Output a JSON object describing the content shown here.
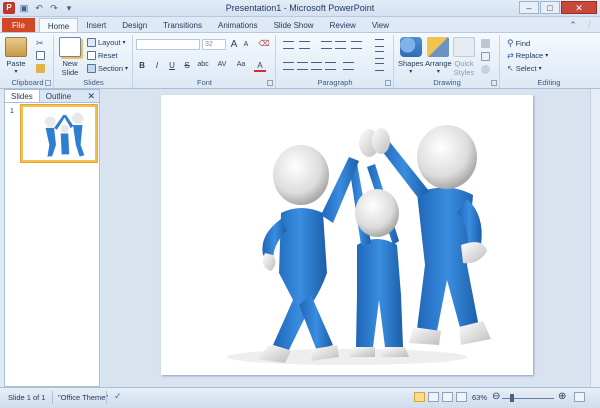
{
  "window": {
    "title": "Presentation1 - Microsoft PowerPoint",
    "quick_access": [
      "save-icon",
      "undo-icon",
      "redo-icon",
      "customize-icon"
    ],
    "controls": [
      "minimize-icon",
      "maximize-icon",
      "close-icon"
    ]
  },
  "tabs": [
    "File",
    "Home",
    "Insert",
    "Design",
    "Transitions",
    "Animations",
    "Slide Show",
    "Review",
    "View"
  ],
  "active_tab": "Home",
  "ribbon": {
    "clipboard": {
      "paste": "Paste",
      "label": "Clipboard"
    },
    "slides": {
      "new_slide_line1": "New",
      "new_slide_line2": "Slide",
      "layout": "Layout",
      "reset": "Reset",
      "section": "Section",
      "label": "Slides"
    },
    "font": {
      "size": "32",
      "label": "Font",
      "bold": "B",
      "italic": "I",
      "underline": "U",
      "strike": "S",
      "shadow": "abc",
      "spacing": "AV",
      "case": "Aa",
      "grow": "A",
      "shrink": "A"
    },
    "paragraph": {
      "label": "Paragraph"
    },
    "drawing": {
      "shapes": "Shapes",
      "arrange": "Arrange",
      "quick_styles_line1": "Quick",
      "quick_styles_line2": "Styles",
      "label": "Drawing"
    },
    "editing": {
      "find": "Find",
      "replace": "Replace",
      "select": "Select",
      "label": "Editing"
    }
  },
  "left_panel": {
    "tabs": [
      "Slides",
      "Outline"
    ],
    "active": "Slides",
    "slide_number": "1"
  },
  "status_bar": {
    "slide_info": "Slide 1 of 1",
    "theme": "\"Office Theme\"",
    "zoom": "63%"
  },
  "colors": {
    "file_tab": "#d24726",
    "figure_blue": "#2f7fd0",
    "selection_gold": "#f2c14e"
  }
}
